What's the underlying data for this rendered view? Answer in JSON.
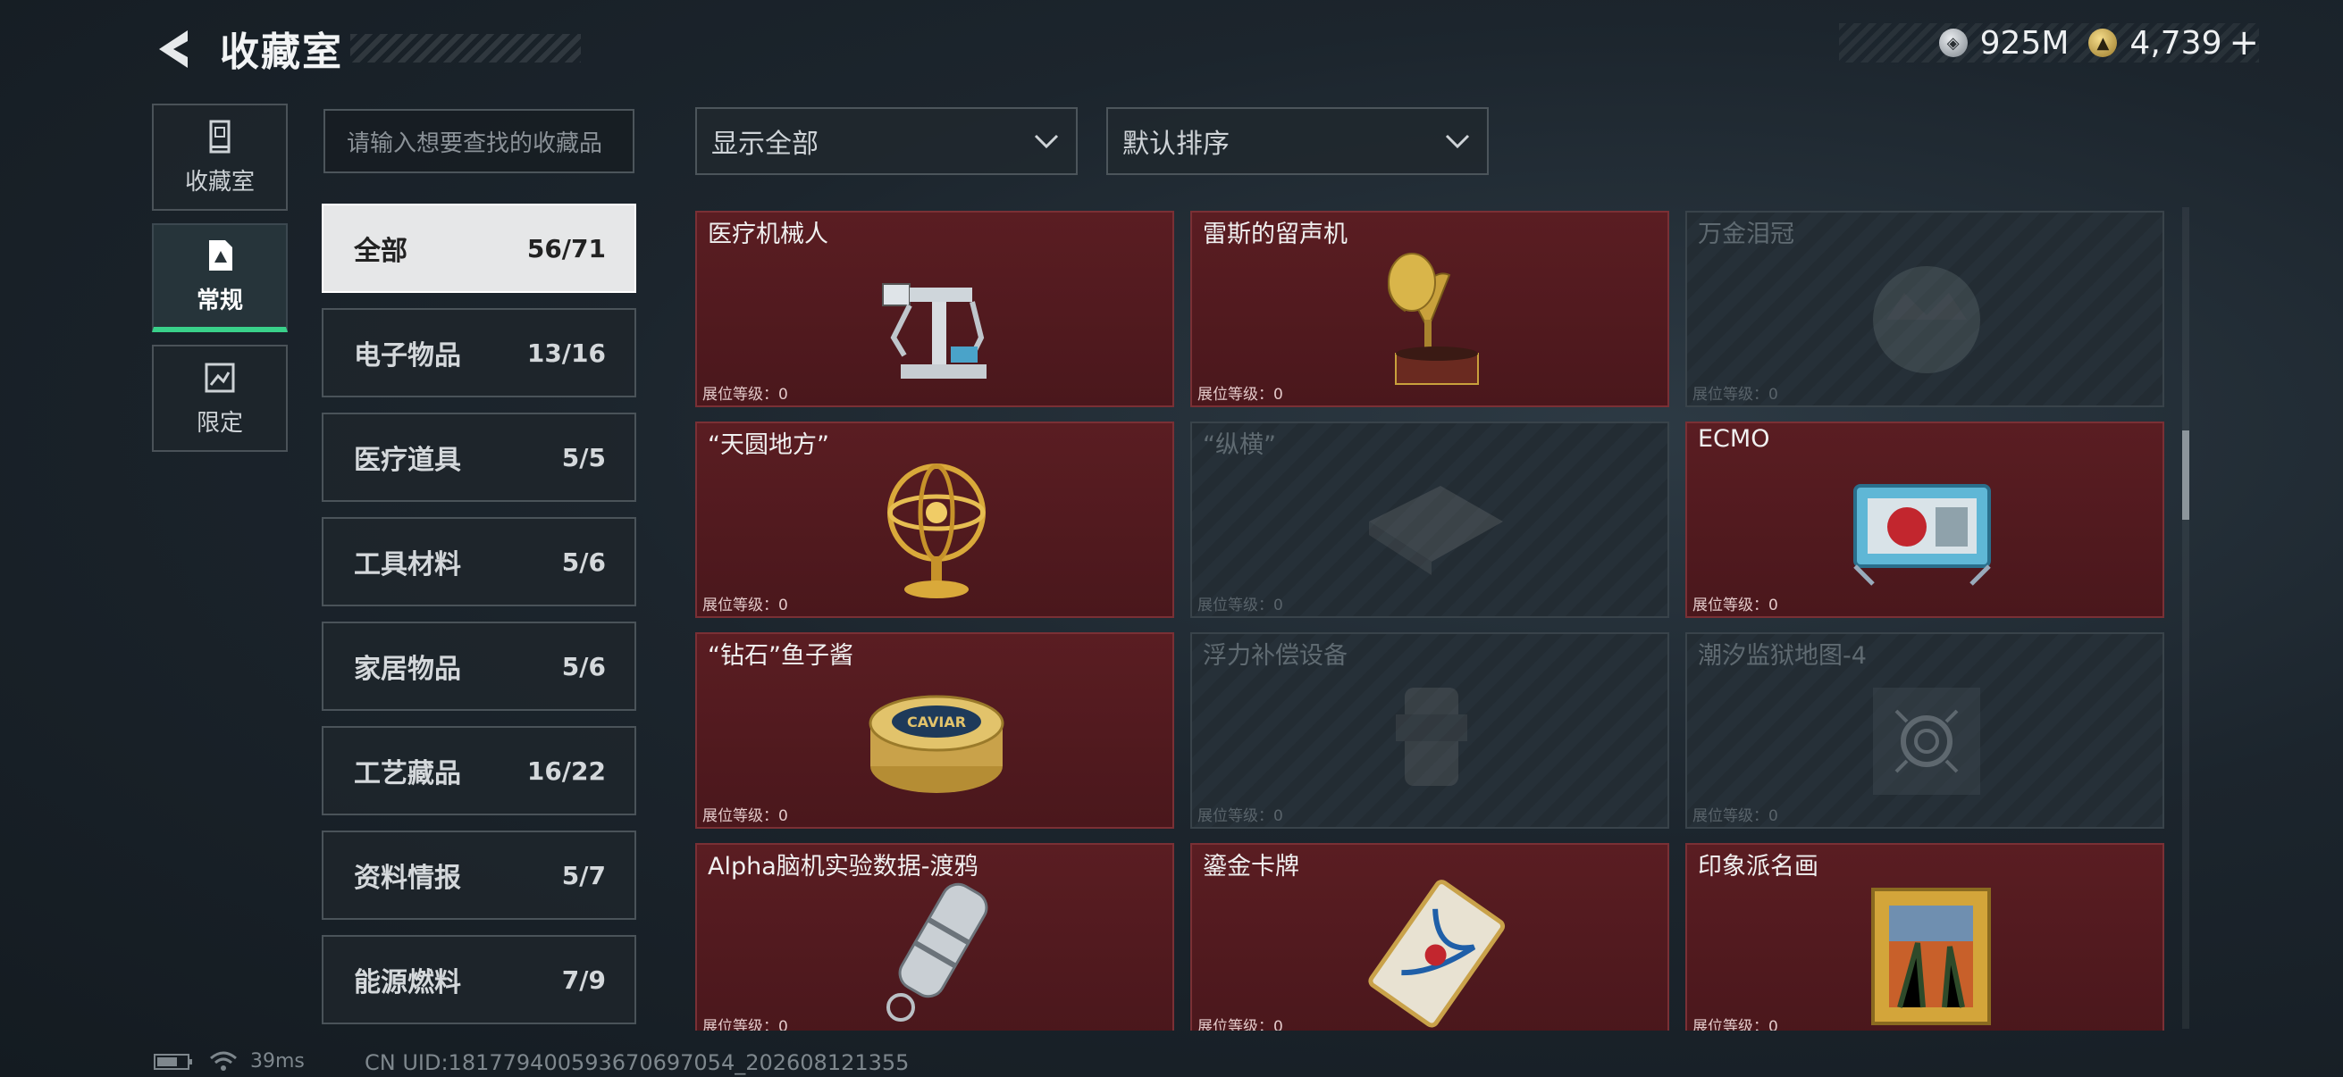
{
  "header": {
    "title": "收藏室"
  },
  "currency": [
    {
      "icon": "silver-coin-icon",
      "value": "925M"
    },
    {
      "icon": "gold-coin-icon",
      "value": "4,739"
    }
  ],
  "side_tabs": [
    {
      "label": "收藏室",
      "icon": "display-case-icon",
      "active": false
    },
    {
      "label": "常规",
      "icon": "document-icon",
      "active": true
    },
    {
      "label": "限定",
      "icon": "limited-icon",
      "active": false
    }
  ],
  "search": {
    "placeholder": "请输入想要查找的收藏品"
  },
  "filters": {
    "display": "显示全部",
    "sort": "默认排序"
  },
  "categories": [
    {
      "name": "全部",
      "count": "56/71"
    },
    {
      "name": "电子物品",
      "count": "13/16"
    },
    {
      "name": "医疗道具",
      "count": "5/5"
    },
    {
      "name": "工具材料",
      "count": "5/6"
    },
    {
      "name": "家居物品",
      "count": "5/6"
    },
    {
      "name": "工艺藏品",
      "count": "16/22"
    },
    {
      "name": "资料情报",
      "count": "5/7"
    },
    {
      "name": "能源燃料",
      "count": "7/9"
    }
  ],
  "items": [
    {
      "name": "医疗机械人",
      "level": "展位等级：0",
      "owned": true,
      "icon": "medical-robot-icon"
    },
    {
      "name": "雷斯的留声机",
      "level": "展位等级：0",
      "owned": true,
      "icon": "gramophone-icon"
    },
    {
      "name": "万金泪冠",
      "level": "展位等级：0",
      "owned": false,
      "icon": "crown-icon"
    },
    {
      "name": "“天圆地方”",
      "level": "展位等级：0",
      "owned": true,
      "icon": "armillary-sphere-icon"
    },
    {
      "name": "“纵横”",
      "level": "展位等级：0",
      "owned": false,
      "icon": "board-game-icon"
    },
    {
      "name": "ECMO",
      "level": "展位等级：0",
      "owned": true,
      "icon": "ecmo-machine-icon"
    },
    {
      "name": "“钻石”鱼子酱",
      "level": "展位等级：0",
      "owned": true,
      "icon": "caviar-tin-icon"
    },
    {
      "name": "浮力补偿设备",
      "level": "展位等级：0",
      "owned": false,
      "icon": "buoyancy-device-icon"
    },
    {
      "name": "潮汐监狱地图-4",
      "level": "展位等级：0",
      "owned": false,
      "icon": "map-target-icon"
    },
    {
      "name": "Alpha脑机实验数据-渡鸦",
      "level": "展位等级：0",
      "owned": true,
      "icon": "data-capsule-icon"
    },
    {
      "name": "鎏金卡牌",
      "level": "展位等级：0",
      "owned": true,
      "icon": "gilded-card-icon"
    },
    {
      "name": "印象派名画",
      "level": "展位等级：0",
      "owned": true,
      "icon": "framed-painting-icon"
    }
  ],
  "caviar_label": "CAVIAR",
  "footer": {
    "ping": "39ms",
    "uid": "CN UID:18177940059367069705​4_202608121355"
  }
}
